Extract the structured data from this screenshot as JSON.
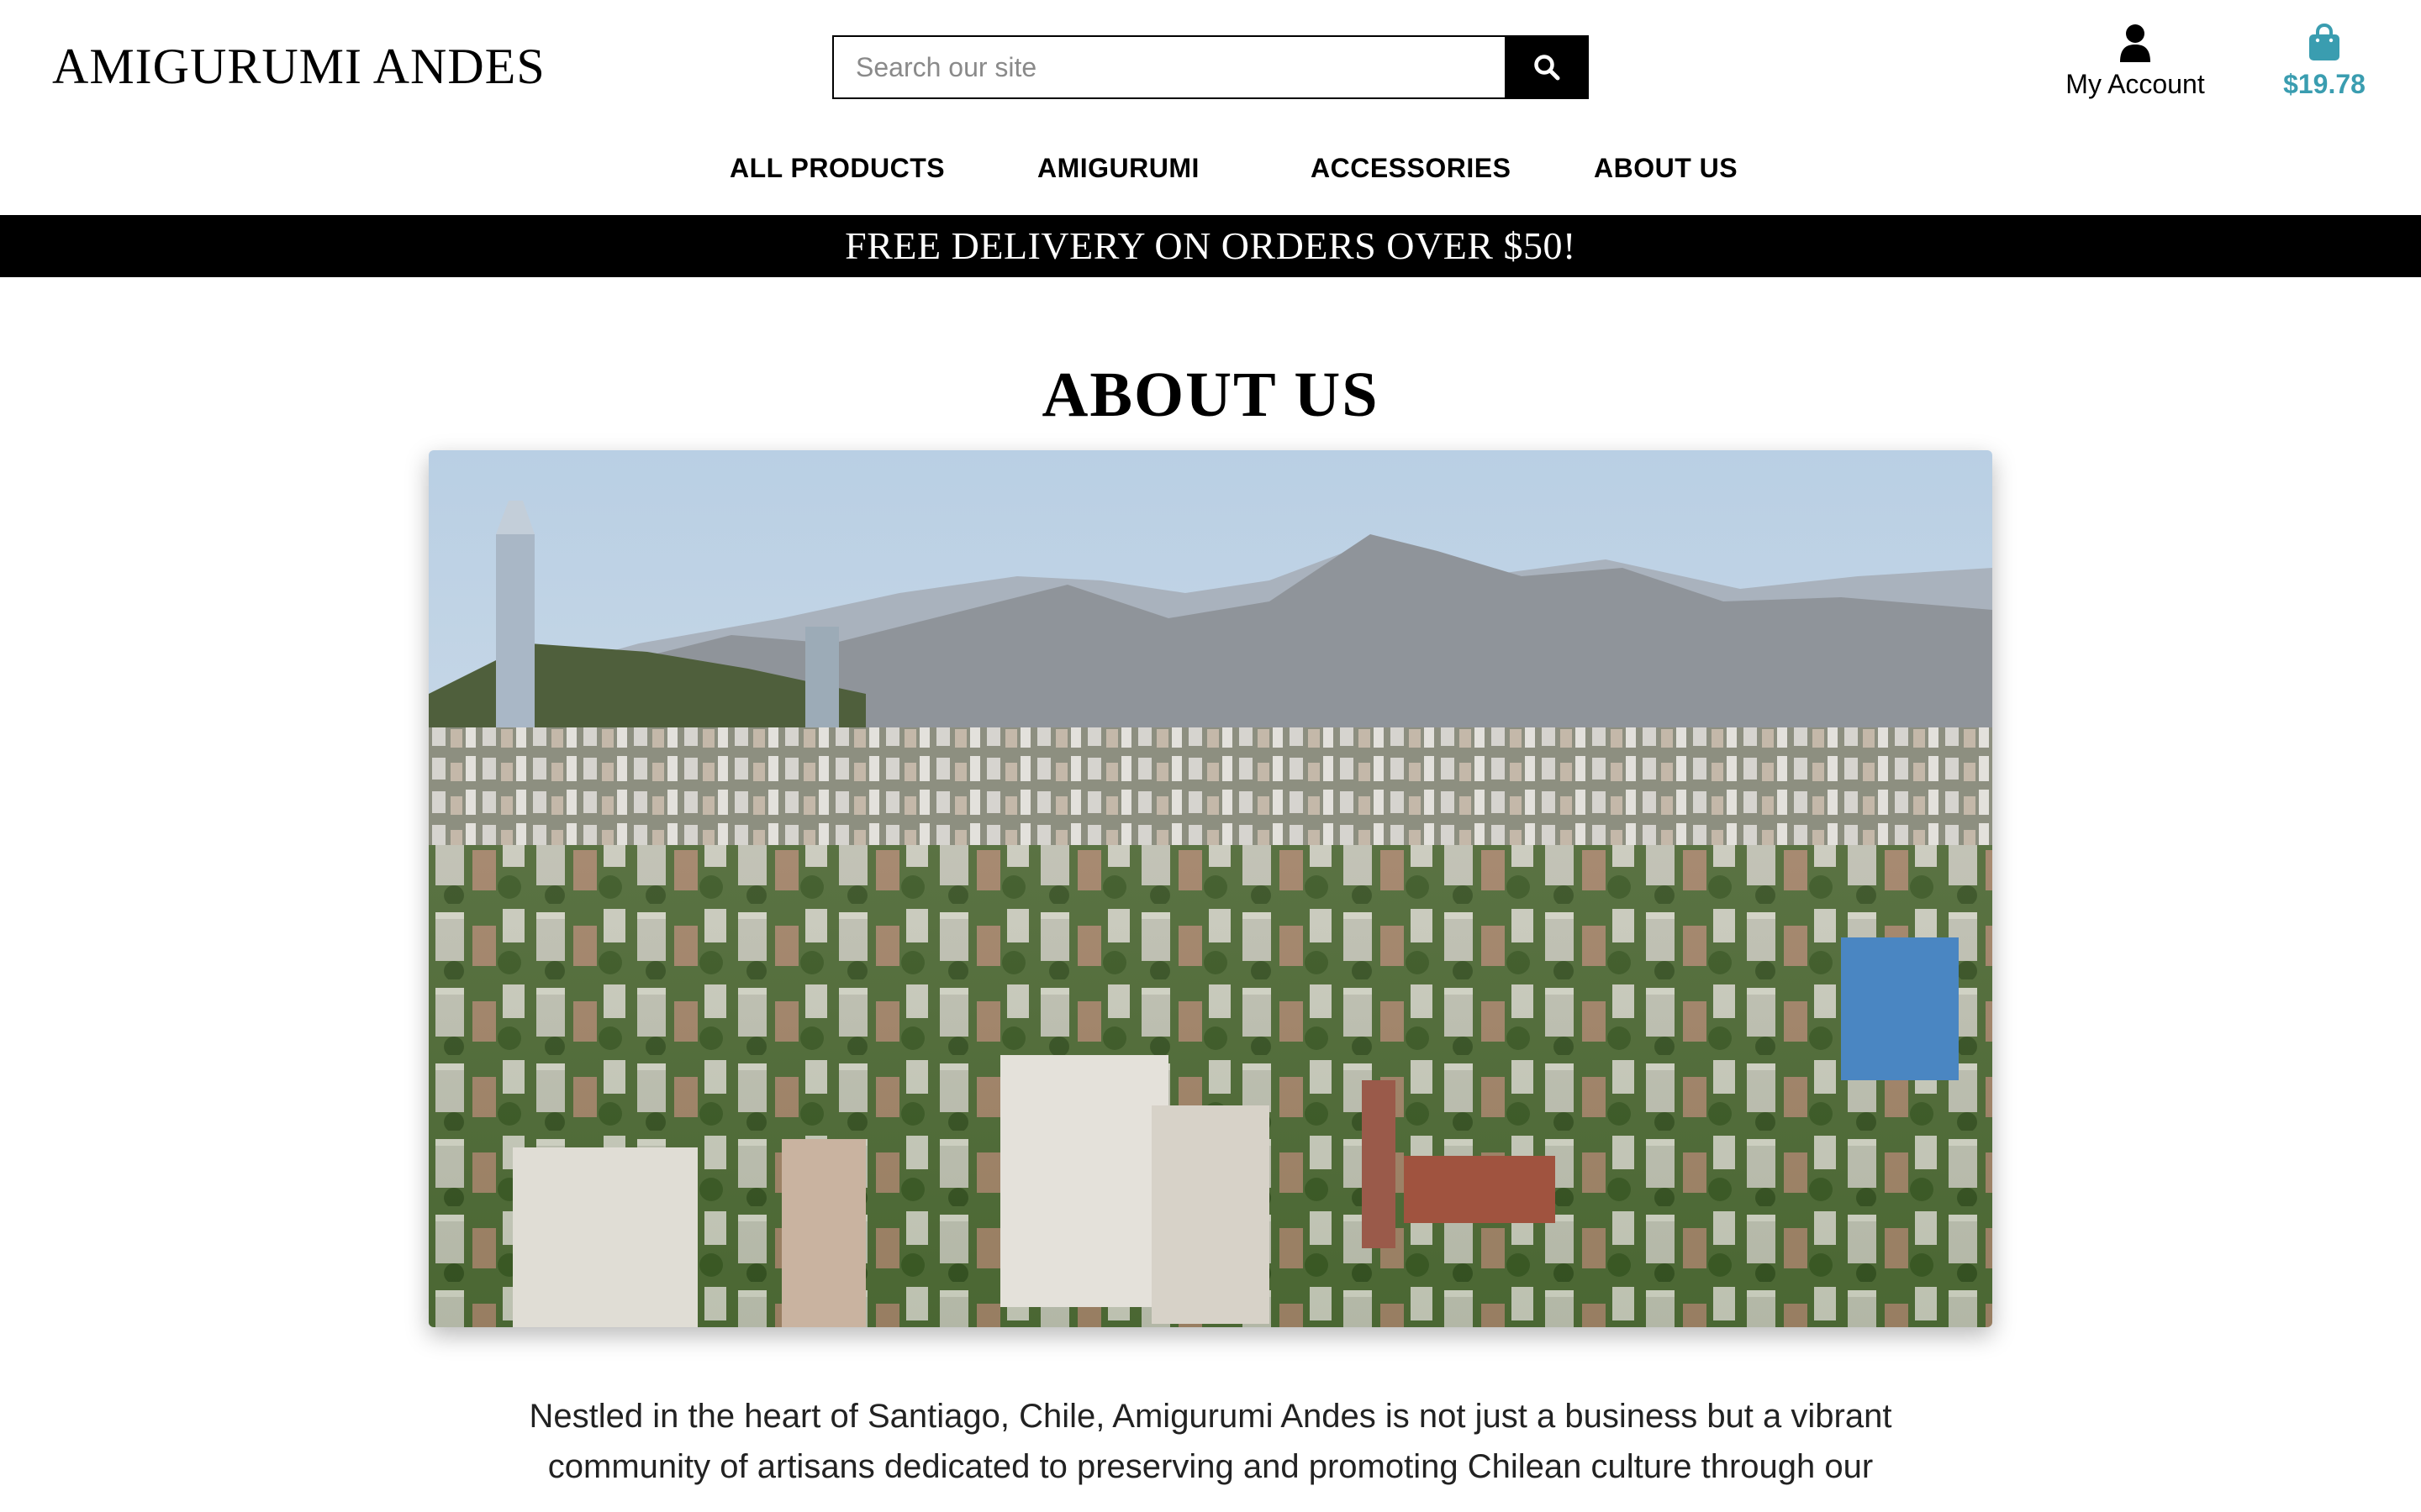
{
  "header": {
    "logo": "AMIGURUMI ANDES",
    "search": {
      "placeholder": "Search our site",
      "value": ""
    },
    "account_label": "My Account",
    "cart_total": "$19.78"
  },
  "nav": {
    "items": [
      "ALL PRODUCTS",
      "AMIGURUMI",
      "ACCESSORIES",
      "ABOUT US"
    ]
  },
  "promo": {
    "text": "FREE DELIVERY ON ORDERS OVER $50!"
  },
  "main": {
    "title": "ABOUT US",
    "intro": "Nestled in the heart of Santiago, Chile, Amigurumi Andes is not just a business but a vibrant community of artisans dedicated to preserving and promoting Chilean culture through our"
  },
  "colors": {
    "accent": "#3a9db0",
    "promo_bg": "#000000",
    "text": "#000000"
  },
  "icons": {
    "search": "search-icon",
    "account": "user-icon",
    "cart": "shopping-bag-icon"
  }
}
